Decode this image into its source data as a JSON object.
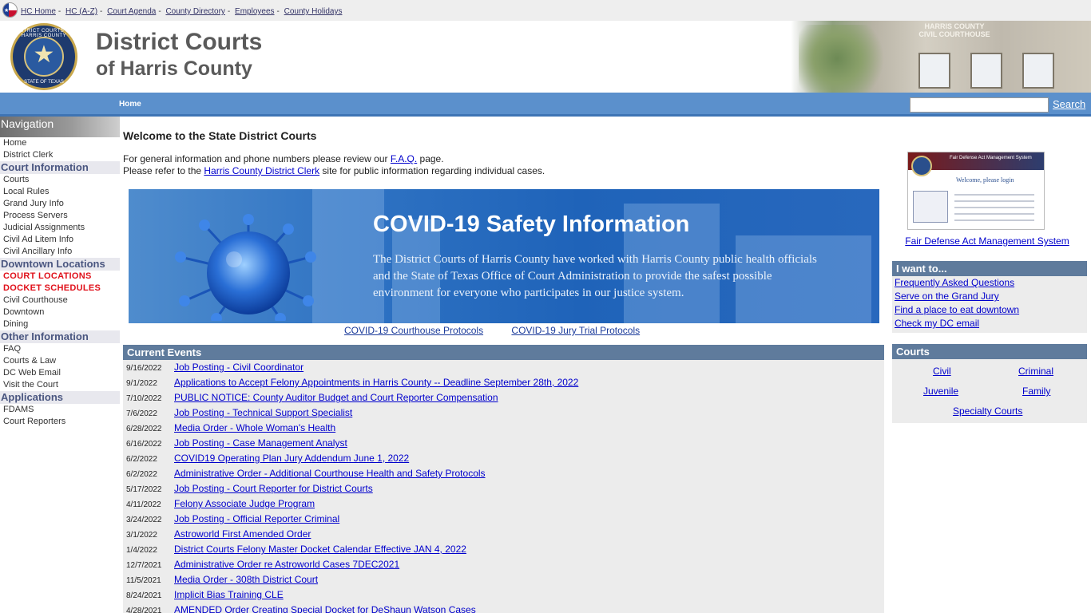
{
  "topbar": {
    "links": [
      "HC Home",
      "HC (A-Z)",
      "Court Agenda",
      "County Directory",
      "Employees",
      "County Holidays"
    ],
    "separator": "-"
  },
  "header": {
    "title_line1": "District Courts",
    "title_line2": "of Harris County",
    "seal_text_top": "DISTRICT COURTS OF HARRIS COUNTY",
    "seal_text_bottom": "STATE OF TEXAS",
    "photo_label_line1": "HARRIS COUNTY",
    "photo_label_line2": "CIVIL COURTHOUSE"
  },
  "navbar": {
    "home": "Home",
    "search_button": "Search",
    "search_value": ""
  },
  "sidebar": {
    "title": "Navigation",
    "items": [
      {
        "type": "link",
        "label": "Home"
      },
      {
        "type": "link",
        "label": "District Clerk"
      },
      {
        "type": "head",
        "label": "Court Information"
      },
      {
        "type": "link",
        "label": "Courts"
      },
      {
        "type": "link",
        "label": "Local Rules"
      },
      {
        "type": "link",
        "label": "Grand Jury Info"
      },
      {
        "type": "link",
        "label": "Process Servers"
      },
      {
        "type": "link",
        "label": "Judicial Assignments"
      },
      {
        "type": "link",
        "label": "Civil Ad Litem Info"
      },
      {
        "type": "link",
        "label": "Civil Ancillary Info"
      },
      {
        "type": "head",
        "label": "Downtown Locations"
      },
      {
        "type": "red",
        "label": "COURT LOCATIONS"
      },
      {
        "type": "red",
        "label": "DOCKET SCHEDULES"
      },
      {
        "type": "link",
        "label": "Civil Courthouse"
      },
      {
        "type": "link",
        "label": "Downtown"
      },
      {
        "type": "link",
        "label": "Dining"
      },
      {
        "type": "head",
        "label": "Other Information"
      },
      {
        "type": "link",
        "label": "FAQ"
      },
      {
        "type": "link",
        "label": "Courts & Law"
      },
      {
        "type": "link",
        "label": "DC Web Email"
      },
      {
        "type": "link",
        "label": "Visit the Court"
      },
      {
        "type": "head",
        "label": "Applications"
      },
      {
        "type": "link",
        "label": "FDAMS"
      },
      {
        "type": "link",
        "label": "Court Reporters"
      }
    ]
  },
  "main": {
    "welcome": "Welcome to the State District Courts",
    "intro_line1_pre": "For general information and phone numbers please review our ",
    "intro_line1_link": "F.A.Q.",
    "intro_line1_post": " page.",
    "intro_line2_pre": "Please refer to the ",
    "intro_line2_link": "Harris County District Clerk",
    "intro_line2_post": " site for public information regarding individual cases.",
    "covid_title": "COVID-19 Safety Information",
    "covid_body": "The District Courts of Harris County have worked with Harris County public health officials and the State of Texas Office of Court Administration to  provide the safest possible environment for everyone who participates in our justice system.",
    "covid_links": [
      "COVID-19 Courthouse Protocols",
      "COVID-19 Jury Trial Protocols"
    ],
    "events_title": "Current Events",
    "events": [
      {
        "date": "9/16/2022",
        "title": "Job Posting - Civil Coordinator"
      },
      {
        "date": "9/1/2022",
        "title": "Applications to Accept Felony Appointments in Harris County -- Deadline September 28th, 2022"
      },
      {
        "date": "7/10/2022",
        "title": "PUBLIC NOTICE: County Auditor Budget and Court Reporter Compensation"
      },
      {
        "date": "7/6/2022",
        "title": "Job Posting - Technical Support Specialist"
      },
      {
        "date": "6/28/2022",
        "title": "Media Order - Whole Woman's Health"
      },
      {
        "date": "6/16/2022",
        "title": "Job Posting - Case Management Analyst"
      },
      {
        "date": "6/2/2022",
        "title": "COVID19 Operating Plan Jury Addendum June 1, 2022"
      },
      {
        "date": "6/2/2022",
        "title": "Administrative Order - Additional Courthouse Health and Safety Protocols"
      },
      {
        "date": "5/17/2022",
        "title": "Job Posting - Court Reporter for District Courts"
      },
      {
        "date": "4/11/2022",
        "title": "Felony Associate Judge Program"
      },
      {
        "date": "3/24/2022",
        "title": "Job Posting - Official Reporter Criminal"
      },
      {
        "date": "3/1/2022",
        "title": "Astroworld First Amended Order"
      },
      {
        "date": "1/4/2022",
        "title": "District Courts Felony Master Docket Calendar Effective JAN 4, 2022"
      },
      {
        "date": "12/7/2021",
        "title": "Administrative Order re Astroworld Cases 7DEC2021"
      },
      {
        "date": "11/5/2021",
        "title": "Media Order - 308th District Court"
      },
      {
        "date": "8/24/2021",
        "title": "Implicit Bias Training CLE"
      },
      {
        "date": "4/28/2021",
        "title": "AMENDED Order Creating Special Docket for DeShaun Watson Cases"
      }
    ]
  },
  "right": {
    "fdams_header": "Fair Defense Act Management System",
    "fdams_welcome": "Welcome, please login",
    "fdams_link": "Fair Defense Act Management System",
    "iwant_title": "I want to...",
    "iwant_links": [
      "Frequently Asked Questions",
      "Serve on the Grand Jury",
      "Find a place to eat downtown",
      "Check my DC email"
    ],
    "courts_title": "Courts",
    "courts_links": [
      "Civil",
      "Criminal",
      "Juvenile",
      "Family",
      "Specialty Courts"
    ]
  },
  "colors": {
    "nav_blue": "#5b90cc",
    "section_head": "#5f7b9c",
    "link": "#0000cc",
    "alert_red": "#e0101a"
  }
}
